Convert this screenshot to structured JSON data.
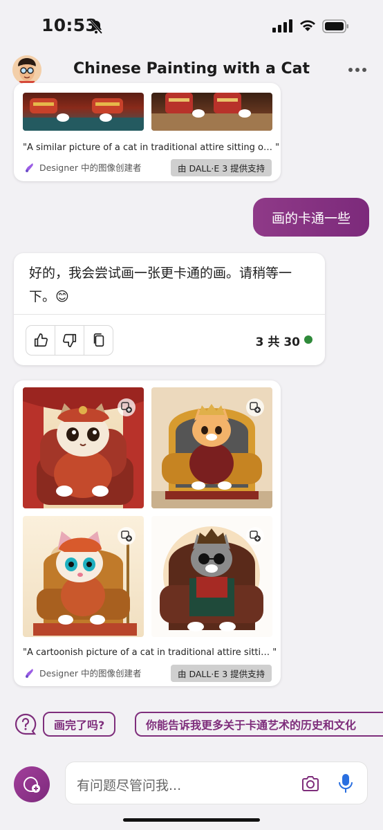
{
  "status": {
    "time": "10:53"
  },
  "header": {
    "title": "Chinese Painting with a Cat"
  },
  "card_prev": {
    "caption": "\"A similar picture of a cat in traditional attire sitting o… \"",
    "designer": "Designer 中的图像创建者",
    "badge": "由 DALL·E 3 提供支持"
  },
  "user_message": "画的卡通一些",
  "bot_message": {
    "text": "好的，我会尝试画一张更卡通的画。请稍等一下。😊",
    "counter": "3 共 30"
  },
  "card_new": {
    "caption": "\"A cartoonish picture of a cat in traditional attire sitti… \"",
    "designer": "Designer 中的图像创建者",
    "badge": "由 DALL·E 3 提供支持"
  },
  "suggestions": [
    "画完了吗?",
    "你能告诉我更多关于卡通艺术的历史和文化"
  ],
  "input": {
    "placeholder": "有问题尽管问我..."
  },
  "colors": {
    "accent": "#7e2d7b",
    "status_dot": "#2f8a3a"
  }
}
